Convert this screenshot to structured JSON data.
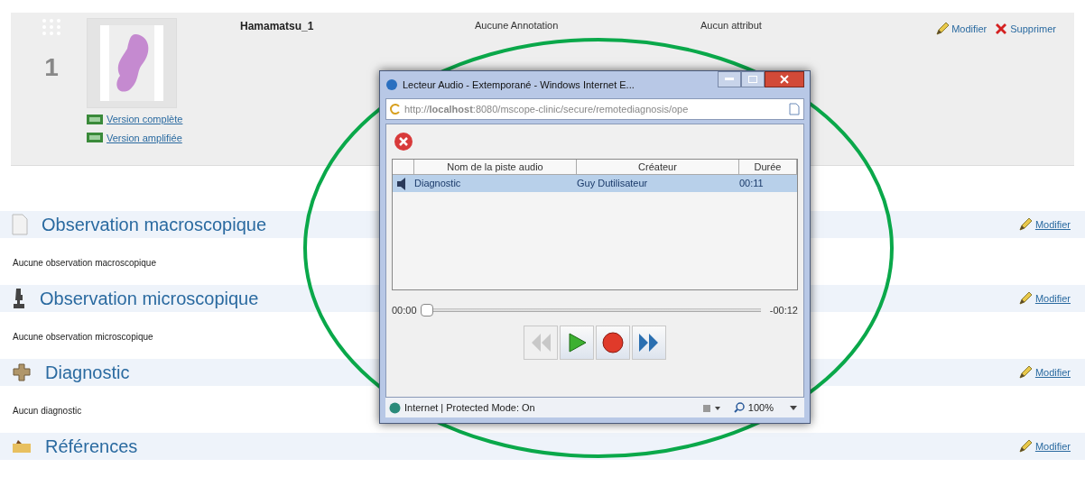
{
  "slide": {
    "number": "1",
    "name": "Hamamatsu_1",
    "annotations": "Aucune Annotation",
    "attributes": "Aucun attribut",
    "links": [
      "Version complète",
      "Version amplifiée"
    ],
    "actions": [
      {
        "kind": "edit",
        "label": "Modifier"
      },
      {
        "kind": "delete",
        "label": "Supprimer"
      }
    ]
  },
  "sections": [
    {
      "kind": "macro",
      "title": "Observation macroscopique",
      "body": "Aucune observation macroscopique",
      "action": "Modifier"
    },
    {
      "kind": "micro",
      "title": "Observation microscopique",
      "body": "Aucune observation microscopique",
      "action": "Modifier"
    },
    {
      "kind": "diagnostic",
      "title": "Diagnostic",
      "body": "Aucun diagnostic",
      "action": "Modifier"
    },
    {
      "kind": "references",
      "title": "Références",
      "action": "Modifier"
    }
  ],
  "popup": {
    "title": "Lecteur Audio - Extemporané - Windows Internet E...",
    "url": "http://**localhost**:8080/mscope-clinic/secure/remotediagnosis/ope",
    "columns": [
      "Nom de la piste audio",
      "Créateur",
      "Durée"
    ],
    "rows": [
      {
        "cells": [
          "Diagnostic",
          "Guy Dutilisateur",
          "00:11"
        ],
        "selected": true
      }
    ],
    "time_start": "00:00",
    "time_end": "-00:12",
    "position": {
      "level": 0
    },
    "controls": [
      {
        "kind": "rewind",
        "disabled": true
      },
      {
        "kind": "play",
        "disabled": false
      },
      {
        "kind": "record",
        "disabled": false
      },
      {
        "kind": "forward",
        "disabled": false
      }
    ],
    "status": "Internet | Protected Mode: On",
    "zoom": "100%"
  }
}
